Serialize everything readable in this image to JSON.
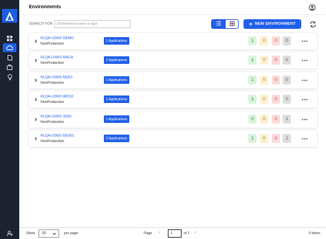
{
  "header": {
    "title": "Environments"
  },
  "search": {
    "label": "SEARCH FOR",
    "placeholder": "Environment name or type",
    "value": ""
  },
  "toolbar": {
    "new_env_label": "NEW ENVIRONMENT"
  },
  "environments": [
    {
      "name": "RLQA-USW2-DEMO",
      "type": "NonProduction",
      "apps": "1 Applications",
      "green": "1",
      "yellow": "0",
      "red": "0",
      "gray": "0"
    },
    {
      "name": "RLQA-USW2-RACH",
      "type": "NonProduction",
      "apps": "1 Applications",
      "green": "1",
      "yellow": "0",
      "red": "0",
      "gray": "0"
    },
    {
      "name": "RLQA-USW2-MQ01",
      "type": "NonProduction",
      "apps": "1 Applications",
      "green": "1",
      "yellow": "0",
      "red": "0",
      "gray": "0"
    },
    {
      "name": "RLQA-USW2-IMC02",
      "type": "NonProduction",
      "apps": "1 Applications",
      "green": "1",
      "yellow": "0",
      "red": "0",
      "gray": "0"
    },
    {
      "name": "RLQA-USW2-SS01",
      "type": "NonProduction",
      "apps": "1 Applications",
      "green": "0",
      "yellow": "0",
      "red": "0",
      "gray": "1"
    },
    {
      "name": "RLQA-USW2-DEV01",
      "type": "NonProduction",
      "apps": "2 Applications",
      "green": "1",
      "yellow": "0",
      "red": "0",
      "gray": "1"
    }
  ],
  "footer": {
    "show_label": "Show",
    "per_page_value": "20",
    "per_page_label": "per page",
    "page_label": "Page",
    "page_value": "1",
    "of_label": "of 1",
    "items_label": "6 items"
  },
  "colors": {
    "accent": "#2160e8",
    "rail": "#1c2230"
  },
  "icons": [
    "logo-icon",
    "dashboard-icon",
    "cloud-icon",
    "document-icon",
    "briefcase-icon",
    "lightbulb-icon",
    "user-settings-icon",
    "user-circle-icon",
    "list-view-icon",
    "grid-view-icon",
    "plus-icon",
    "refresh-icon",
    "chevron-right-icon",
    "more-icon"
  ]
}
